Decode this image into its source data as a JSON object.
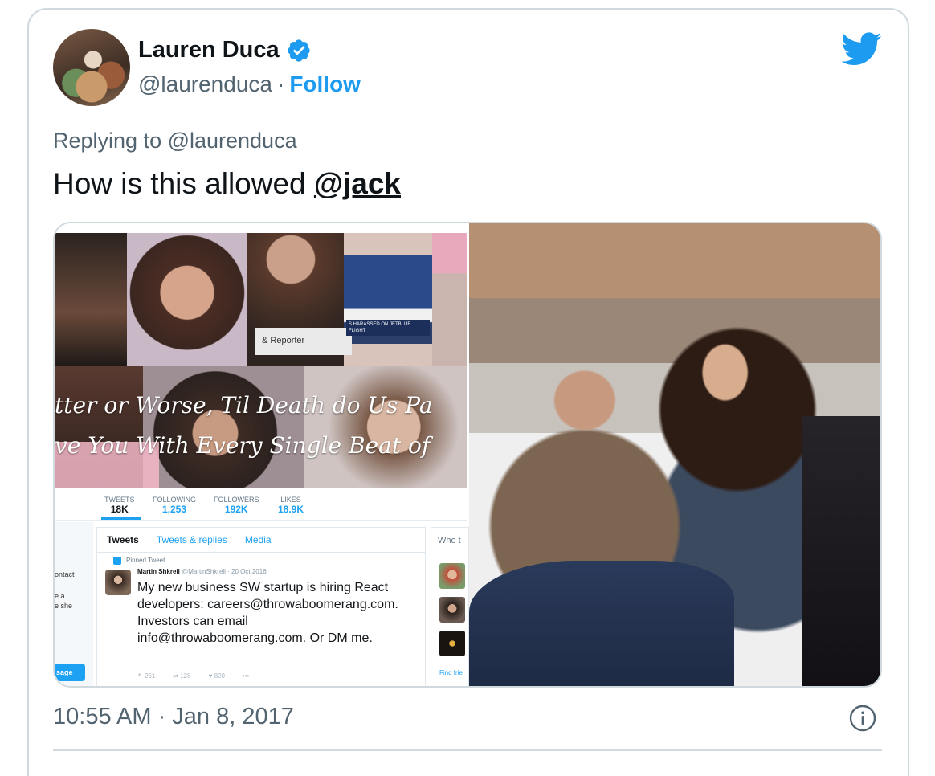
{
  "author": {
    "name": "Lauren Duca",
    "handle": "@laurenduca",
    "separator": "·",
    "follow_label": "Follow"
  },
  "icons": {
    "verified": "verified-badge-icon",
    "brand": "twitter-bird-icon",
    "info": "info-icon"
  },
  "colors": {
    "accent": "#1d9bf0",
    "text": "#0f1419",
    "secondary": "#536471",
    "border": "#cfd9de"
  },
  "tweet": {
    "replying_to": "Replying to @laurenduca",
    "text_prefix": "How is this allowed ",
    "mention": "@jack",
    "timestamp": "10:55 AM · Jan 8, 2017"
  },
  "embedded_screenshot": {
    "banner_reporter": "& Reporter",
    "banner_news": "S HARASSED ON JETBLUE FLIGHT",
    "banner_script_1": "tter or Worse, Til Death do Us Pa",
    "banner_script_2": "ve You With Every Single Beat of",
    "stats": [
      {
        "label": "TWEETS",
        "value": "18K"
      },
      {
        "label": "FOLLOWING",
        "value": "1,253"
      },
      {
        "label": "FOLLOWERS",
        "value": "192K"
      },
      {
        "label": "LIKES",
        "value": "18.9K"
      }
    ],
    "tabs": [
      "Tweets",
      "Tweets & replies",
      "Media"
    ],
    "pinned_label": "Pinned Tweet",
    "pinned_author": "Martin Shkreli",
    "pinned_meta": "@MartinShkreli · 20 Oct 2016",
    "pinned_text": "My new business SW startup is hiring React developers: careers@throwaboomerang.com. Investors can email info@throwaboomerang.com. Or DM me.",
    "actions": {
      "reply": "261",
      "retweet": "128",
      "like": "820",
      "more": "•••"
    },
    "sidebar": {
      "contact": "ontact",
      "asshe": "e a\ne she",
      "message": "sage"
    },
    "whoto_label": "Who t",
    "find_label": "Find frie"
  }
}
